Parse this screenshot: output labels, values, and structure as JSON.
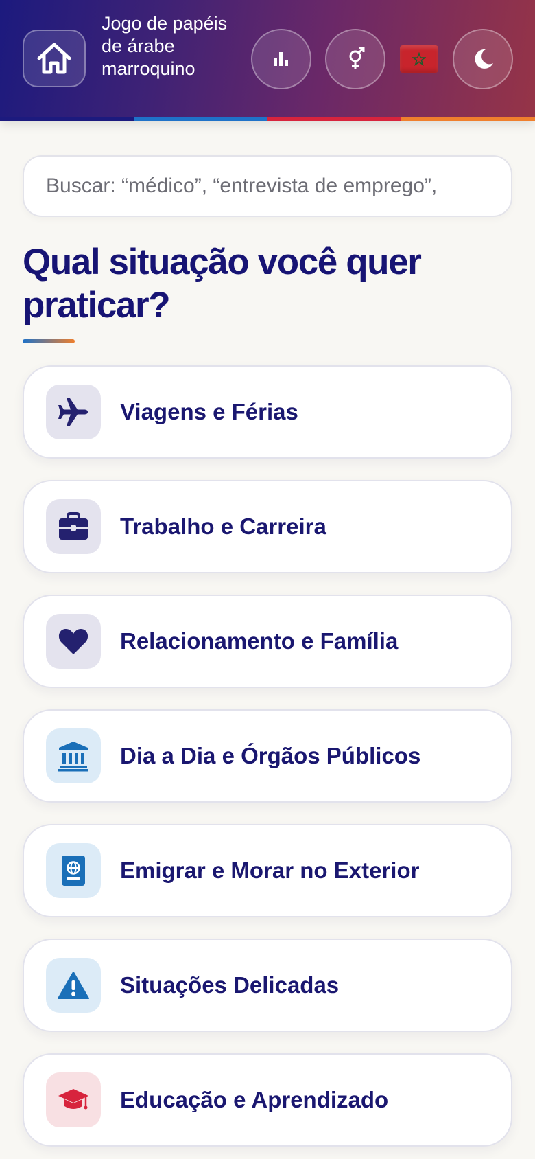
{
  "header": {
    "title": "Jogo de papéis de árabe marroquino",
    "home_icon": "home-icon",
    "stats_icon": "bar-chart-icon",
    "gender_icon": "gender-icon",
    "flag_icon": "morocco-flag-icon",
    "theme_icon": "moon-icon",
    "stripe_colors": [
      "#1c1a7e",
      "#1f72c8",
      "#d7243d",
      "#ef7f2d"
    ]
  },
  "search": {
    "placeholder": "Buscar: “médico”, “entrevista de emprego”,"
  },
  "main": {
    "heading": "Qual situação você quer praticar?",
    "categories": [
      {
        "label": "Viagens e Férias",
        "icon": "airplane-icon",
        "icon_bg": "#e4e3ee",
        "icon_color": "#24216f"
      },
      {
        "label": "Trabalho e Carreira",
        "icon": "briefcase-icon",
        "icon_bg": "#e4e3ee",
        "icon_color": "#24216f"
      },
      {
        "label": "Relacionamento e Família",
        "icon": "heart-icon",
        "icon_bg": "#e4e3ee",
        "icon_color": "#24216f"
      },
      {
        "label": "Dia a Dia e Órgãos Públicos",
        "icon": "government-building-icon",
        "icon_bg": "#dcebf7",
        "icon_color": "#1a6fb8"
      },
      {
        "label": "Emigrar e Morar no Exterior",
        "icon": "passport-icon",
        "icon_bg": "#dcebf7",
        "icon_color": "#1a6fb8"
      },
      {
        "label": "Situações Delicadas",
        "icon": "warning-icon",
        "icon_bg": "#dcebf7",
        "icon_color": "#1a6fb8"
      },
      {
        "label": "Educação e Aprendizado",
        "icon": "graduation-cap-icon",
        "icon_bg": "#f8e0e3",
        "icon_color": "#d7243d"
      }
    ]
  },
  "colors": {
    "brand_navy": "#171474",
    "accent_blue": "#1f72c8",
    "accent_red": "#d7243d",
    "accent_orange": "#ef7f2d",
    "page_bg": "#f8f7f3"
  }
}
